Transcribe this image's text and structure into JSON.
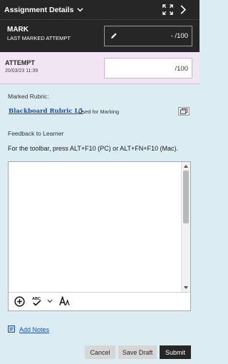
{
  "header": {
    "title": "Assignment Details",
    "icons": {
      "dropdown": "chevron-down-icon",
      "expand": "expand-icon",
      "next": "chevron-right-icon"
    }
  },
  "mark": {
    "title": "MARK",
    "subtitle": "LAST MARKED ATTEMPT",
    "value": "- /100",
    "icon": "pencil-icon"
  },
  "attempt": {
    "title": "ATTEMPT",
    "date": "20/03/23 11:39",
    "value": "/100"
  },
  "rubric": {
    "label": "Marked Rubric:",
    "name": "Blackboard Rubric L5",
    "status": "Used for Marking",
    "icon": "rubric-view-icon"
  },
  "feedback": {
    "label": "Feedback to Learner",
    "toolbar_hint": "For the toolbar, press ALT+F10 (PC) or ALT+FN+F10 (Mac).",
    "content": "",
    "toolbar_icons": [
      "add-content-icon",
      "spellcheck-icon",
      "chevron-down-icon",
      "format-text-icon"
    ]
  },
  "notes": {
    "label": "Add Notes",
    "icon": "notes-icon"
  },
  "actions": {
    "cancel": "Cancel",
    "save_draft": "Save Draft",
    "submit": "Submit"
  },
  "colors": {
    "header_bg": "#262626",
    "attempt_bg": "#f1e4f3",
    "panel_bg": "#dbecf3",
    "link": "#1f4f9a"
  }
}
